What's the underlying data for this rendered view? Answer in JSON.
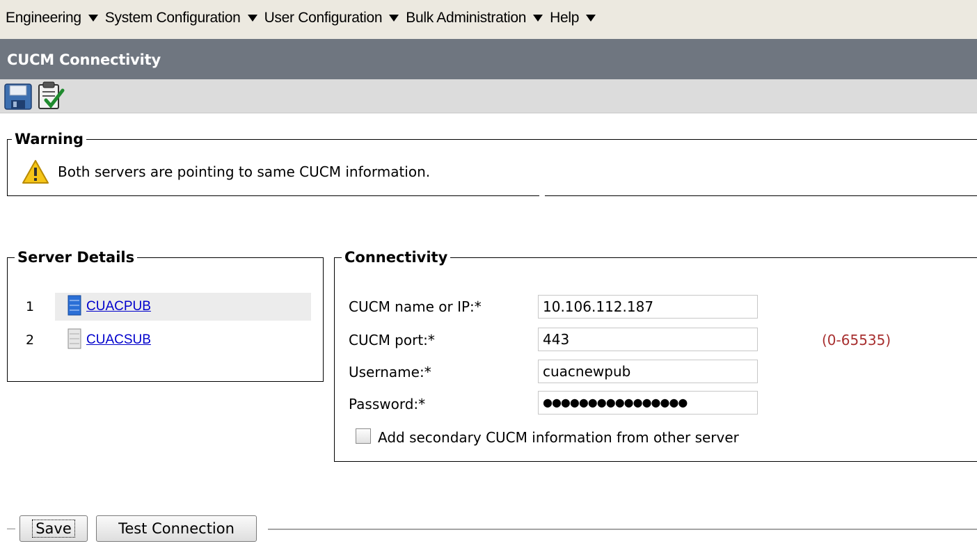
{
  "menu": [
    {
      "label": "Engineering"
    },
    {
      "label": "System Configuration"
    },
    {
      "label": "User Configuration"
    },
    {
      "label": "Bulk Administration"
    },
    {
      "label": "Help"
    }
  ],
  "page_title": "CUCM Connectivity",
  "toolbar": {
    "save_icon": "floppy-disk-icon",
    "test_icon": "clipboard-check-icon"
  },
  "warning": {
    "legend": "Warning",
    "icon": "warning-triangle-icon",
    "message": "Both servers are pointing to same CUCM information."
  },
  "server_details": {
    "legend": "Server Details",
    "servers": [
      {
        "num": "1",
        "name": "CUACPUB",
        "icon": "server-active-icon",
        "selected": true
      },
      {
        "num": "2",
        "name": "CUACSUB",
        "icon": "server-inactive-icon",
        "selected": false
      }
    ]
  },
  "connectivity": {
    "legend": "Connectivity",
    "name_label": "CUCM name or IP:*",
    "name_value": "10.106.112.187",
    "port_label": "CUCM port:*",
    "port_value": "443",
    "port_hint": "(0-65535)",
    "username_label": "Username:*",
    "username_value": "cuacnewpub",
    "password_label": "Password:*",
    "password_value": "●●●●●●●●●●●●●●●●",
    "secondary_label": "Add secondary CUCM information from other server",
    "secondary_checked": false
  },
  "buttons": {
    "save": "Save",
    "test": "Test Connection"
  },
  "colors": {
    "title_bar": "#6f7680",
    "menu_bar": "#ece9e0",
    "link": "#0000cc",
    "hint": "#a83030"
  }
}
